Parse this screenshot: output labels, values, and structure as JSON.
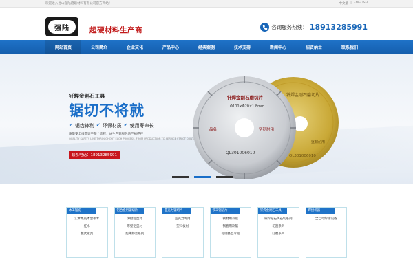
{
  "topbar": {
    "welcome": "欢迎进入昆山强陆磨砺材料有限公司官方网站！",
    "lang_cn": "中文版",
    "lang_sep": "|",
    "lang_en": "ENGLISH"
  },
  "header": {
    "logo_text": "强陆",
    "slogan": "超硬材料生产商",
    "hotline_label": "咨询服务热线：",
    "hotline_number": "18913285991"
  },
  "nav": {
    "items": [
      {
        "label": "网站首页"
      },
      {
        "label": "公司简介"
      },
      {
        "label": "企业文化"
      },
      {
        "label": "产品中心"
      },
      {
        "label": "经典案例"
      },
      {
        "label": "技术支持"
      },
      {
        "label": "新闻中心"
      },
      {
        "label": "招贤纳士"
      },
      {
        "label": "联系我们"
      }
    ]
  },
  "banner": {
    "subtitle": "钎焊金刚石工具",
    "title": "锯切不将就",
    "features": [
      "锯齿锋利",
      "环保材质",
      "使用寿命长"
    ],
    "desc": "质量安全线贯穿于每个流程，从生产到服务均严格把控",
    "desc_en": "QUALITY SAFETY LINE THROUGHOUT EACH PROCESS, FROM PRODUCTION TO SERVICE STRICT CONTROL",
    "contact": "联系电话：18913285991",
    "disc_front_text": "钎焊金刚石磨切片",
    "disc_front_size": "Φ100×Φ20×1.8mm",
    "disc_front_left": "品名",
    "disc_front_right": "坚韧耐用",
    "disc_front_code": "QL301006010",
    "disc_back_text": "钎焊金刚石磨切片",
    "disc_back_right": "坚韧耐用",
    "disc_back_code": "QL301006010",
    "colors": {
      "accent": "#1a6ec8",
      "red": "#c8161d",
      "silver": "#c9ccd1",
      "gold": "#c9a836"
    }
  },
  "products": [
    {
      "title": "木工锯切",
      "items": [
        "实木集成木合板木",
        "红木",
        "板式家具"
      ]
    },
    {
      "title": "铝合金用锯切片",
      "items": [
        "薄壁铝型材",
        "厚壁铝型材",
        "超薄静音系列"
      ]
    },
    {
      "title": "亚克力锯切片",
      "items": [
        "亚克力专用",
        "塑料板材"
      ]
    },
    {
      "title": "铁工锯切片",
      "items": [
        "钢材用冷锯",
        "钢管用冷锯",
        "可调整型冷锯"
      ]
    },
    {
      "title": "钎焊金刚石工具",
      "items": [
        "钎焊钻石英石切系列",
        "切割系列",
        "打磨系列"
      ]
    },
    {
      "title": "焊接机器",
      "items": [
        "全自动焊接设备"
      ]
    }
  ]
}
